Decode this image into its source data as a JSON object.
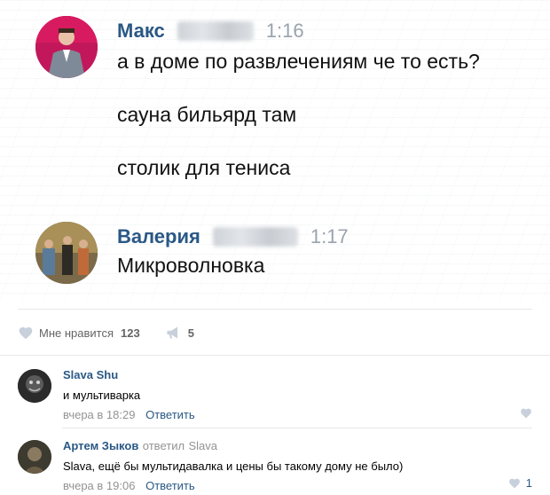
{
  "chat": {
    "messages": [
      {
        "name": "Макс",
        "time": "1:16",
        "lines": [
          "а в доме по развлечениям че то есть?",
          "сауна бильярд там",
          "столик для тениса"
        ]
      },
      {
        "name": "Валерия",
        "time": "1:17",
        "lines": [
          "Микроволновка"
        ]
      }
    ]
  },
  "post_actions": {
    "like_label": "Мне нравится",
    "like_count": "123",
    "share_count": "5"
  },
  "comments": [
    {
      "author": "Slava Shu",
      "text": "и мультиварка",
      "date": "вчера в 18:29",
      "reply_label": "Ответить",
      "likes": ""
    },
    {
      "author": "Артем Зыков",
      "replied_label": "ответил",
      "reply_to": "Slava",
      "text": "Slava, ещё бы мультидавалка и цены бы такому дому не было)",
      "date": "вчера в 19:06",
      "reply_label": "Ответить",
      "likes": "1"
    }
  ],
  "colors": {
    "link": "#2a5885",
    "muted": "#939393",
    "like_icon": "#c7d0db"
  },
  "icons": [
    "heart-icon",
    "megaphone-icon",
    "heart-icon"
  ]
}
